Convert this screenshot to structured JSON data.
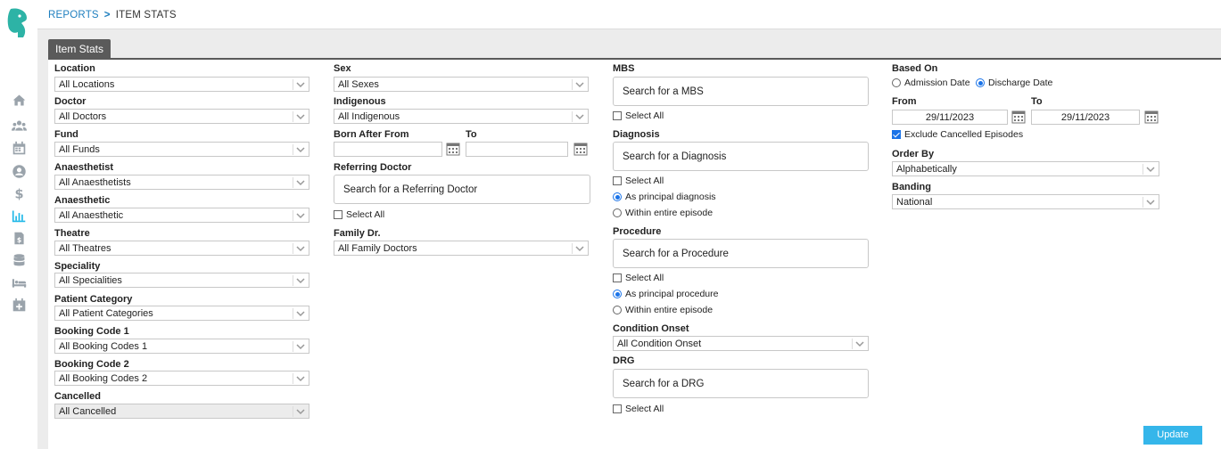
{
  "breadcrumb": {
    "parent": "REPORTS",
    "separator": ">",
    "current": "ITEM STATS"
  },
  "tab": {
    "label": "Item Stats"
  },
  "col1": {
    "location": {
      "label": "Location",
      "value": "All Locations"
    },
    "doctor": {
      "label": "Doctor",
      "value": "All Doctors"
    },
    "fund": {
      "label": "Fund",
      "value": "All Funds"
    },
    "anaesthetist": {
      "label": "Anaesthetist",
      "value": "All Anaesthetists"
    },
    "anaesthetic": {
      "label": "Anaesthetic",
      "value": "All Anaesthetic"
    },
    "theatre": {
      "label": "Theatre",
      "value": "All Theatres"
    },
    "speciality": {
      "label": "Speciality",
      "value": "All Specialities"
    },
    "patient_category": {
      "label": "Patient Category",
      "value": "All Patient Categories"
    },
    "booking_code_1": {
      "label": "Booking Code 1",
      "value": "All Booking Codes 1"
    },
    "booking_code_2": {
      "label": "Booking Code 2",
      "value": "All Booking Codes 2"
    },
    "cancelled": {
      "label": "Cancelled",
      "value": "All Cancelled"
    }
  },
  "col2": {
    "sex": {
      "label": "Sex",
      "value": "All Sexes"
    },
    "indigenous": {
      "label": "Indigenous",
      "value": "All Indigenous"
    },
    "born_after": {
      "label_from": "Born After From",
      "label_to": "To",
      "from_value": "",
      "to_value": ""
    },
    "referring_doctor": {
      "label": "Referring Doctor",
      "placeholder": "Search for a Referring Doctor",
      "select_all": "Select All"
    },
    "family_dr": {
      "label": "Family Dr.",
      "value": "All Family Doctors"
    }
  },
  "col3": {
    "mbs": {
      "label": "MBS",
      "placeholder": "Search for a MBS",
      "select_all": "Select All"
    },
    "diagnosis": {
      "label": "Diagnosis",
      "placeholder": "Search for a Diagnosis",
      "select_all": "Select All",
      "opt_principal": "As principal diagnosis",
      "opt_entire": "Within entire episode",
      "selected": "principal"
    },
    "procedure": {
      "label": "Procedure",
      "placeholder": "Search for a Procedure",
      "select_all": "Select All",
      "opt_principal": "As principal procedure",
      "opt_entire": "Within entire episode",
      "selected": "principal"
    },
    "condition_onset": {
      "label": "Condition Onset",
      "value": "All Condition Onset"
    },
    "drg": {
      "label": "DRG",
      "placeholder": "Search for a DRG",
      "select_all": "Select All"
    }
  },
  "col4": {
    "based_on": {
      "label": "Based On",
      "opt_admission": "Admission Date",
      "opt_discharge": "Discharge Date",
      "selected": "discharge"
    },
    "from": {
      "label": "From",
      "value": "29/11/2023"
    },
    "to": {
      "label": "To",
      "value": "29/11/2023"
    },
    "exclude_cancelled": {
      "label": "Exclude Cancelled Episodes",
      "checked": true
    },
    "order_by": {
      "label": "Order By",
      "value": "Alphabetically"
    },
    "banding": {
      "label": "Banding",
      "value": "National"
    }
  },
  "update_button": {
    "label": "Update"
  },
  "colors": {
    "accent": "#35b6ea",
    "link": "#1f7fbf",
    "tab": "#5a5a5a",
    "nav_icon": "#9aa3ab",
    "nav_active": "#20b8e8",
    "logo": "#2db3a6"
  }
}
